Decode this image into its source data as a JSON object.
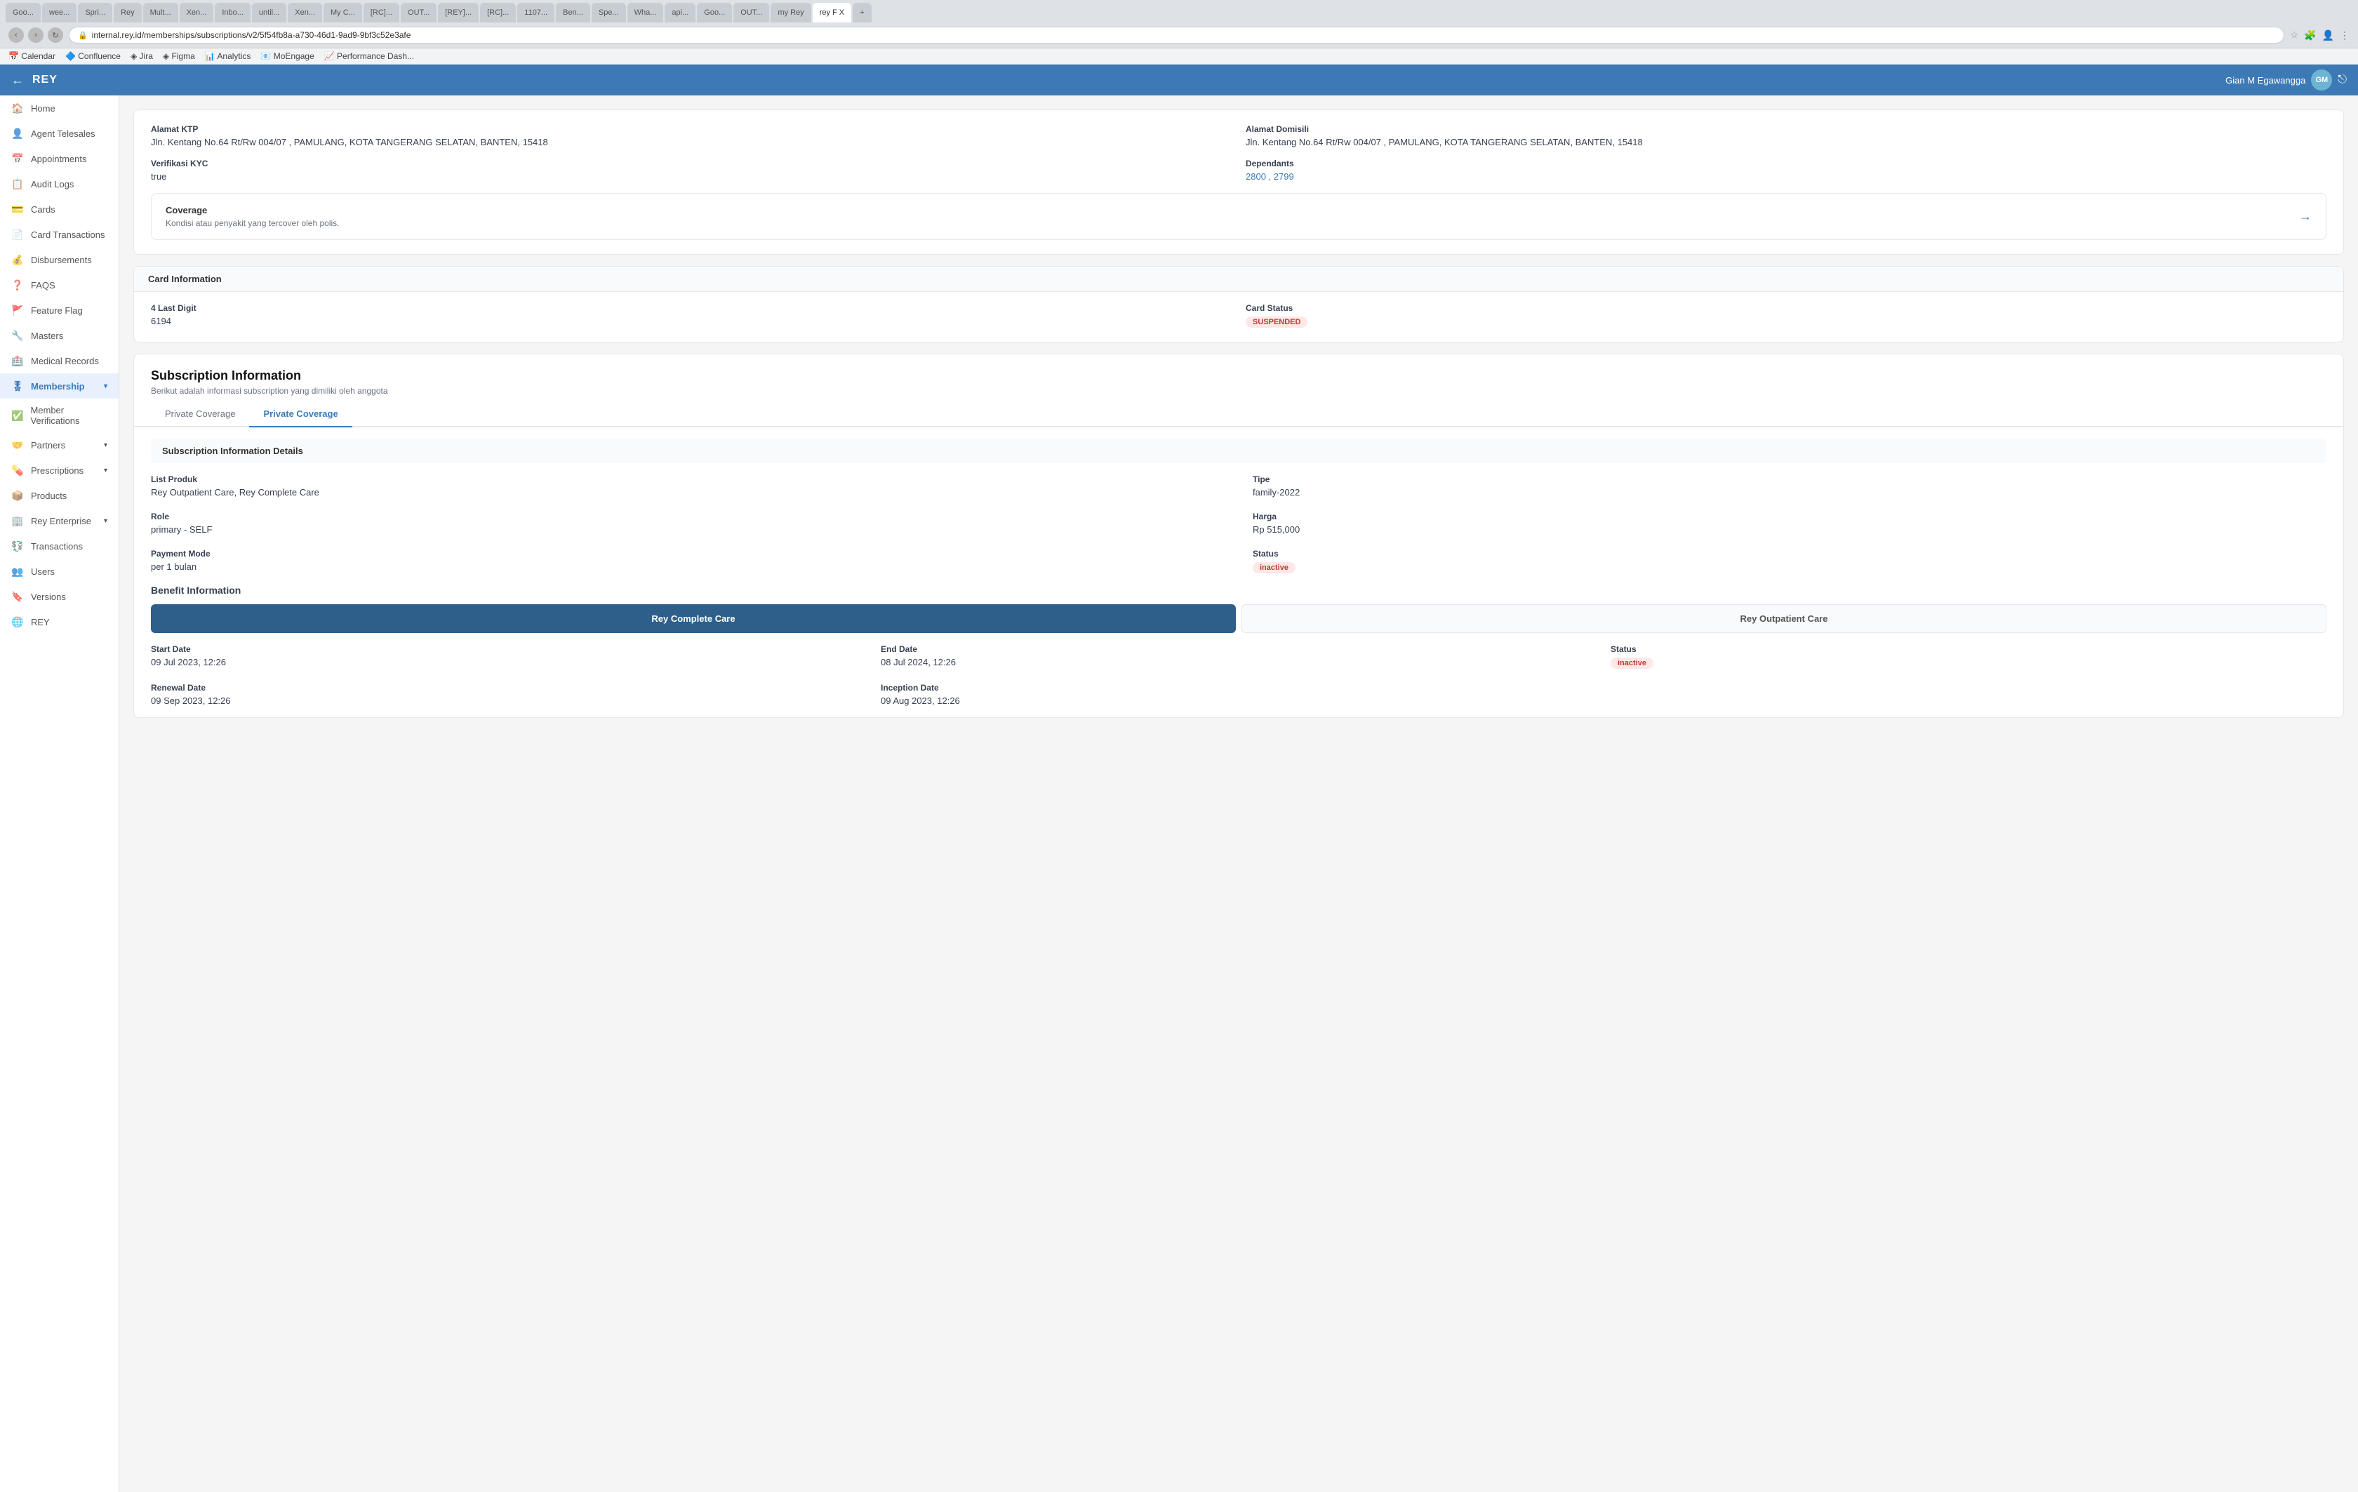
{
  "browser": {
    "address": "internal.rey.id/memberships/subscriptions/v2/5f54fb8a-a730-46d1-9ad9-9bf3c52e3afe",
    "tabs": [
      {
        "label": "Goo...",
        "active": false
      },
      {
        "label": "wee...",
        "active": false
      },
      {
        "label": "Spri...",
        "active": false
      },
      {
        "label": "Rey",
        "active": false
      },
      {
        "label": "Mult...",
        "active": false
      },
      {
        "label": "Xen...",
        "active": false
      },
      {
        "label": "Inbo...",
        "active": false
      },
      {
        "label": "until...",
        "active": false
      },
      {
        "label": "Xen...",
        "active": false
      },
      {
        "label": "My C...",
        "active": false
      },
      {
        "label": "[RC]...",
        "active": false
      },
      {
        "label": "OUT...",
        "active": false
      },
      {
        "label": "[REY]...",
        "active": false
      },
      {
        "label": "[RC]...",
        "active": false
      },
      {
        "label": "1107...",
        "active": false
      },
      {
        "label": "Ben...",
        "active": false
      },
      {
        "label": "Spe...",
        "active": false
      },
      {
        "label": "Wha...",
        "active": false
      },
      {
        "label": "api...",
        "active": false
      },
      {
        "label": "Goo...",
        "active": false
      },
      {
        "label": "OUT...",
        "active": false
      },
      {
        "label": "my Rey",
        "active": false
      },
      {
        "label": "rey F X",
        "active": true
      }
    ],
    "bookmarks": [
      "Calendar",
      "Confluence",
      "Jira",
      "Figma",
      "Analytics",
      "MoEngage",
      "Performance Dash..."
    ]
  },
  "app": {
    "title": "REY",
    "user": "Gian M Egawangga",
    "user_initials": "GM"
  },
  "sidebar": {
    "items": [
      {
        "label": "Home",
        "icon": "🏠",
        "active": false
      },
      {
        "label": "Agent Telesales",
        "icon": "👤",
        "active": false
      },
      {
        "label": "Appointments",
        "icon": "📅",
        "active": false
      },
      {
        "label": "Audit Logs",
        "icon": "📋",
        "active": false
      },
      {
        "label": "Cards",
        "icon": "💳",
        "active": false
      },
      {
        "label": "Card Transactions",
        "icon": "📄",
        "active": false
      },
      {
        "label": "Disbursements",
        "icon": "💰",
        "active": false
      },
      {
        "label": "FAQS",
        "icon": "❓",
        "active": false
      },
      {
        "label": "Feature Flag",
        "icon": "🚩",
        "active": false
      },
      {
        "label": "Masters",
        "icon": "🔧",
        "active": false
      },
      {
        "label": "Medical Records",
        "icon": "🏥",
        "active": false
      },
      {
        "label": "Membership",
        "icon": "🎖",
        "active": true,
        "has_chevron": true
      },
      {
        "label": "Member Verifications",
        "icon": "✅",
        "active": false
      },
      {
        "label": "Partners",
        "icon": "🤝",
        "active": false,
        "has_chevron": true
      },
      {
        "label": "Prescriptions",
        "icon": "💊",
        "active": false,
        "has_chevron": true
      },
      {
        "label": "Products",
        "icon": "📦",
        "active": false
      },
      {
        "label": "Rey Enterprise",
        "icon": "🏢",
        "active": false,
        "has_chevron": true
      },
      {
        "label": "Transactions",
        "icon": "💱",
        "active": false
      },
      {
        "label": "Users",
        "icon": "👥",
        "active": false
      },
      {
        "label": "Versions",
        "icon": "🔖",
        "active": false
      },
      {
        "label": "REY",
        "icon": "🌐",
        "active": false
      }
    ]
  },
  "content": {
    "address_ktp": {
      "label": "Alamat KTP",
      "value": "Jln. Kentang No.64 Rt/Rw 004/07 , PAMULANG, KOTA TANGERANG SELATAN, BANTEN, 15418"
    },
    "address_domisili": {
      "label": "Alamat Domisili",
      "value": "Jln. Kentang No.64 Rt/Rw 004/07 , PAMULANG, KOTA TANGERANG SELATAN, BANTEN, 15418"
    },
    "kyc": {
      "label": "Verifikasi KYC",
      "value": "true"
    },
    "dependants": {
      "label": "Dependants",
      "value": "2800 , 2799"
    },
    "coverage": {
      "title": "Coverage",
      "description": "Kondisi atau penyakit yang tercover oleh polis."
    },
    "card_info": {
      "section_title": "Card Information",
      "last_digit_label": "4 Last Digit",
      "last_digit_value": "6194",
      "status_label": "Card Status",
      "status_value": "SUSPENDED"
    },
    "subscription": {
      "title": "Subscription Information",
      "subtitle": "Berikut adalah informasi subscription yang dimiliki oleh anggota",
      "tabs": [
        {
          "label": "Private Coverage",
          "active": false
        },
        {
          "label": "Private Coverage",
          "active": true
        }
      ],
      "section_title": "Subscription Information Details",
      "list_produk_label": "List Produk",
      "list_produk_value": "Rey Outpatient Care, Rey Complete Care",
      "tipe_label": "Tipe",
      "tipe_value": "family-2022",
      "role_label": "Role",
      "role_value": "primary - SELF",
      "harga_label": "Harga",
      "harga_value": "Rp 515,000",
      "payment_mode_label": "Payment Mode",
      "payment_mode_value": "per 1 bulan",
      "status_label": "Status",
      "status_value": "inactive",
      "benefit_title": "Benefit Information",
      "benefit_tabs": [
        {
          "label": "Rey Complete Care",
          "active": true
        },
        {
          "label": "Rey Outpatient Care",
          "active": false
        }
      ],
      "start_date_label": "Start Date",
      "start_date_value": "09 Jul 2023, 12:26",
      "end_date_label": "End Date",
      "end_date_value": "08 Jul 2024, 12:26",
      "benefit_status_label": "Status",
      "benefit_status_value": "inactive",
      "renewal_date_label": "Renewal Date",
      "renewal_date_value": "09 Sep 2023, 12:26",
      "inception_date_label": "Inception Date",
      "inception_date_value": "09 Aug 2023, 12:26"
    }
  }
}
